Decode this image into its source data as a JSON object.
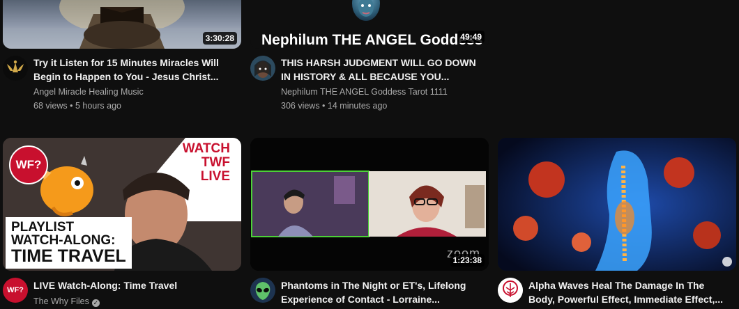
{
  "videos_row1": [
    {
      "title": "Try it Listen for 15 Minutes Miracles Will Begin to Happen to You - Jesus Christ...",
      "channel": "Angel Miracle Healing Music",
      "meta": "68 views • 5 hours ago",
      "duration": "3:30:28",
      "avatar_icon": "golden-angel-logo-icon"
    },
    {
      "title": "THIS HARSH JUDGMENT WILL GO DOWN IN HISTORY & ALL BECAUSE YOU...",
      "channel": "Nephilum THE ANGEL Goddess Tarot 1111",
      "meta": "306 views • 14 minutes ago",
      "duration": "49:49",
      "thumb_text": "Nephilum THE ANGEL Goddess",
      "avatar_icon": "goddess-face-avatar-icon"
    }
  ],
  "videos_row2": [
    {
      "title": "LIVE Watch-Along: Time Travel",
      "channel": "The Why Files",
      "verified": "✓",
      "thumb_badge": "WF?",
      "thumb_watch": "WATCH",
      "thumb_twf": "TWF",
      "thumb_live": "LIVE",
      "thumb_playlist": "PLAYLIST",
      "thumb_watchalong": "WATCH-ALONG:",
      "thumb_timetravel": "TIME TRAVEL",
      "avatar_text": "WF?"
    },
    {
      "title": "Phantoms in The Night or ET's, Lifelong Experience of Contact - Lorraine...",
      "channel": "",
      "duration": "1:23:38",
      "thumb_zoom": "zoom",
      "avatar_icon": "alien-avatar-icon"
    },
    {
      "title": "Alpha Waves Heal The Damage In The Body, Powerful Effect, Immediate Effect,...",
      "channel": "",
      "avatar_icon": "tree-logo-avatar-icon"
    }
  ],
  "colors": {
    "background": "#0f0f0f",
    "title": "#f1f1f1",
    "secondary_text": "#aaaaaa",
    "twf_red": "#c8102e"
  }
}
